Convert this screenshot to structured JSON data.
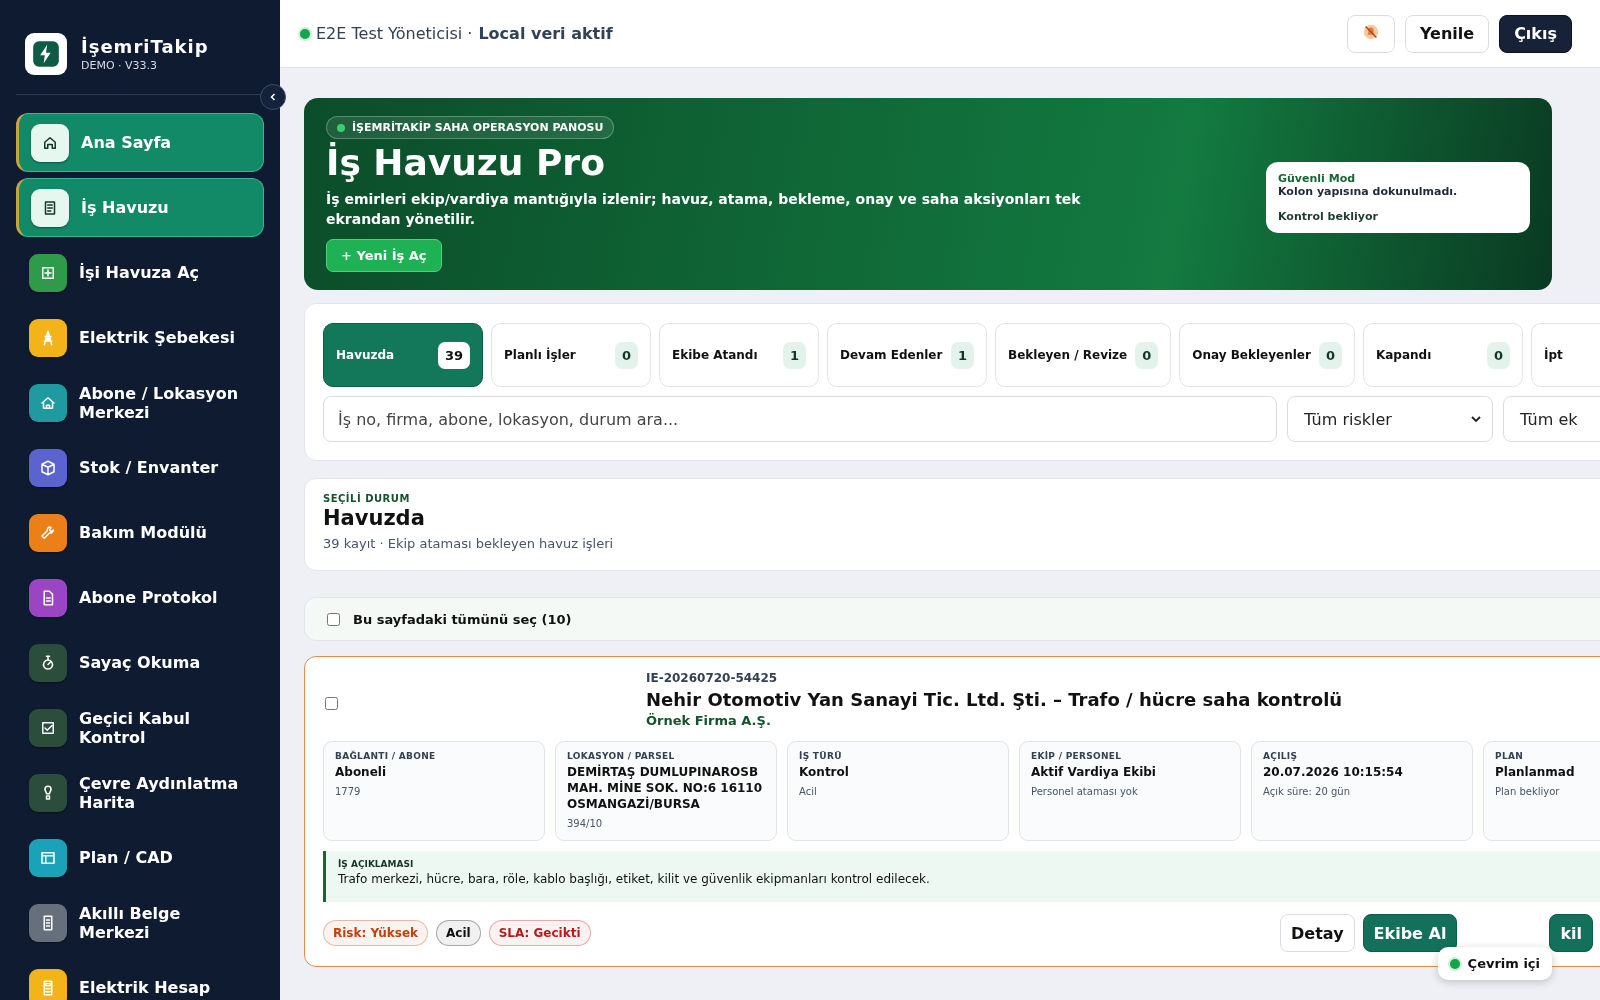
{
  "brand": {
    "name": "İşemriTakip",
    "version": "DEMO · V33.3"
  },
  "sidebar": {
    "items": [
      {
        "label": "Ana Sayfa",
        "selected": true,
        "color": "#e6f7ef"
      },
      {
        "label": "İş Havuzu",
        "selected": true,
        "color": "#e6f7ef"
      },
      {
        "label": "İşi Havuza Aç",
        "selected": false,
        "color": "#2f9a4a"
      },
      {
        "label": "Elektrik Şebekesi",
        "selected": false,
        "color": "#f2b418"
      },
      {
        "label": "Abone / Lokasyon Merkezi",
        "selected": false,
        "color": "#1e9aa0"
      },
      {
        "label": "Stok / Envanter",
        "selected": false,
        "color": "#5b63cf"
      },
      {
        "label": "Bakım Modülü",
        "selected": false,
        "color": "#ec8018"
      },
      {
        "label": "Abone Protokol",
        "selected": false,
        "color": "#9a46c4"
      },
      {
        "label": "Sayaç Okuma",
        "selected": false,
        "color": "#2b4d3c"
      },
      {
        "label": "Geçici Kabul Kontrol",
        "selected": false,
        "color": "#2b4d3c"
      },
      {
        "label": "Çevre Aydınlatma Harita",
        "selected": false,
        "color": "#2b4d3c"
      },
      {
        "label": "Plan / CAD",
        "selected": false,
        "color": "#1aa3b8"
      },
      {
        "label": "Akıllı Belge Merkezi",
        "selected": false,
        "color": "#66707c"
      },
      {
        "label": "Elektrik Hesap",
        "selected": false,
        "color": "#f2b418"
      }
    ]
  },
  "header": {
    "user": "E2E Test Yöneticisi ·",
    "mode": "Local veri aktif",
    "online": true,
    "buttons": [
      {
        "label": "Yenile",
        "kind": "light"
      },
      {
        "label": "Çıkış",
        "kind": "dark"
      }
    ]
  },
  "hero": {
    "eyebrow": "İŞEMRİTAKİP SAHA OPERASYON PANOSU",
    "title": "İş Havuzu Pro",
    "description": "İş emirleri ekip/vardiya mantığıyla izlenir; havuz, atama, bekleme, onay ve saha aksiyonları tek ekrandan yönetilir.",
    "action": "+ Yeni İş Aç",
    "notice": {
      "title": "Güvenli Mod",
      "line": "Kolon yapısına dokunulmadı.",
      "status": "Kontrol bekliyor"
    }
  },
  "status_tabs": [
    {
      "label": "Havuzda",
      "count": "39",
      "selected": true
    },
    {
      "label": "Planlı İşler",
      "count": "0",
      "selected": false
    },
    {
      "label": "Ekibe Atandı",
      "count": "1",
      "selected": false
    },
    {
      "label": "Devam Edenler",
      "count": "1",
      "selected": false
    },
    {
      "label": "Bekleyen / Revize",
      "count": "0",
      "selected": false
    },
    {
      "label": "Onay Bekleyenler",
      "count": "0",
      "selected": false
    },
    {
      "label": "Kapandı",
      "count": "0",
      "selected": false
    },
    {
      "label": "İpt",
      "selected": false
    }
  ],
  "search": {
    "placeholder": "İş no, firma, abone, lokasyon, durum ara..."
  },
  "filters": [
    "Tüm riskler",
    "Tüm ek"
  ],
  "selected_status": {
    "eyebrow": "SEÇİLİ DURUM",
    "title": "Havuzda",
    "summary": "39 kayıt · Ekip ataması bekleyen havuz işleri"
  },
  "select_all": {
    "label": "Bu sayfadaki tümünü seç (10)",
    "checked": false
  },
  "job": {
    "checked": false,
    "id": "IE-20260720-54425",
    "title": "Nehir Otomotiv Yan Sanayi Tic. Ltd. Şti. – Trafo / hücre saha kontrolü",
    "company": "Örnek Firma A.Ş.",
    "fields": [
      {
        "label": "BAĞLANTI / ABONE",
        "value": "Aboneli",
        "note": "1779"
      },
      {
        "label": "LOKASYON / PARSEL",
        "value": "DEMİRTAŞ DUMLUPINAROSB MAH. MİNE SOK. NO:6 16110 OSMANGAZİ/BURSA",
        "note": "394/10"
      },
      {
        "label": "İŞ TÜRÜ",
        "value": "Kontrol",
        "note": "Acil"
      },
      {
        "label": "EKİP / PERSONEL",
        "value": "Aktif Vardiya Ekibi",
        "note": "Personel ataması yok"
      },
      {
        "label": "AÇILIŞ",
        "value": "20.07.2026 10:15:54",
        "note": "Açık süre: 20 gün"
      },
      {
        "label": "PLAN",
        "value": "Planlanmad",
        "note": "Plan bekliyor"
      }
    ],
    "description": {
      "label": "İŞ AÇIKLAMASI",
      "text": "Trafo merkezi, hücre, bara, röle, kablo başlığı, etiket, kilit ve güvenlik ekipmanları kontrol edilecek."
    },
    "tags": [
      {
        "label": "Risk: Yüksek",
        "color": "#c2410c"
      },
      {
        "label": "Acil",
        "color": "#111111"
      },
      {
        "label": "SLA: Gecikti",
        "color": "#b91c1c"
      }
    ],
    "actions": [
      {
        "label": "Detay",
        "kind": "light"
      },
      {
        "label": "Ekibe Al",
        "kind": "primary"
      },
      {
        "label": "kil",
        "kind": "primary"
      }
    ]
  },
  "connection": {
    "label": "Çevrim içi",
    "online": true
  }
}
